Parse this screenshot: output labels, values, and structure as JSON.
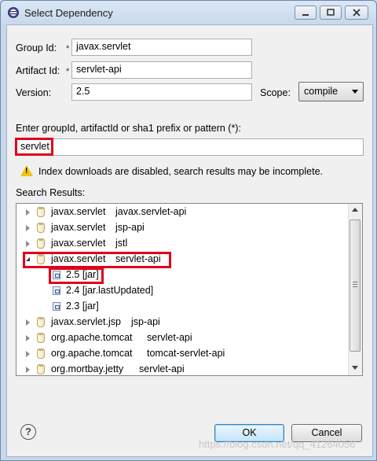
{
  "window": {
    "title": "Select Dependency"
  },
  "form": {
    "group_id_label": "Group Id:",
    "group_id_value": "javax.servlet",
    "artifact_id_label": "Artifact Id:",
    "artifact_id_value": "servlet-api",
    "version_label": "Version:",
    "version_value": "2.5",
    "scope_label": "Scope:",
    "scope_value": "compile",
    "required_marker": "*"
  },
  "search": {
    "label": "Enter groupId, artifactId or sha1 prefix or pattern (*):",
    "value": "servlet",
    "warning": "Index downloads are disabled, search results may be incomplete.",
    "results_label": "Search Results:"
  },
  "results": [
    {
      "group": "javax.servlet",
      "artifact": "javax.servlet-api",
      "expanded": false
    },
    {
      "group": "javax.servlet",
      "artifact": "jsp-api",
      "expanded": false
    },
    {
      "group": "javax.servlet",
      "artifact": "jstl",
      "expanded": false
    },
    {
      "group": "javax.servlet",
      "artifact": "servlet-api",
      "expanded": true
    },
    {
      "version": "2.5 [jar]"
    },
    {
      "version": "2.4 [jar.lastUpdated]"
    },
    {
      "version": "2.3 [jar]"
    },
    {
      "group": "javax.servlet.jsp",
      "artifact": "jsp-api",
      "expanded": false
    },
    {
      "group": "org.apache.tomcat",
      "artifact": "servlet-api",
      "expanded": false
    },
    {
      "group": "org.apache.tomcat",
      "artifact": "tomcat-servlet-api",
      "expanded": false
    },
    {
      "group": "org.mortbay.jetty",
      "artifact": "servlet-api",
      "expanded": false
    }
  ],
  "buttons": {
    "ok": "OK",
    "cancel": "Cancel",
    "help": "?"
  },
  "watermark": "https://blog.csdn.net/qq_41264056",
  "colors": {
    "highlight": "#e0001b",
    "accent": "#3c7fb1"
  }
}
